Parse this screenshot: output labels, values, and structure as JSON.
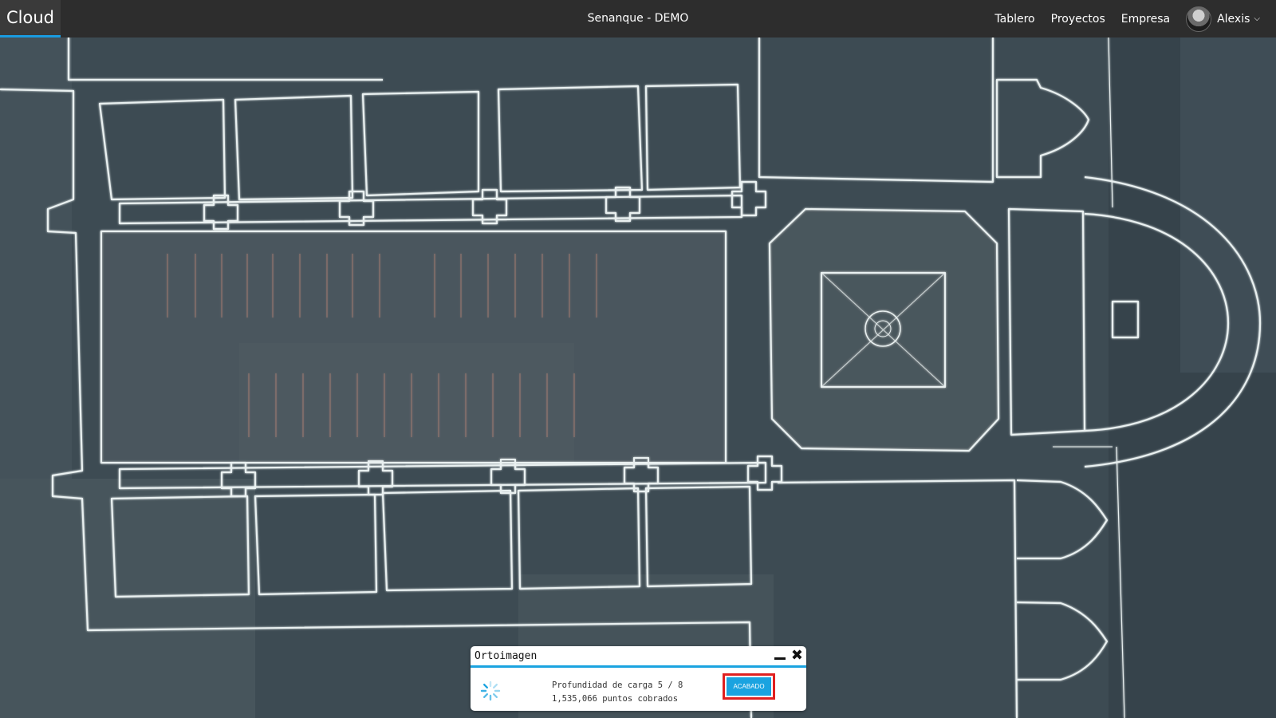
{
  "header": {
    "brand": "Cloud",
    "project_title": "Senanque - DEMO",
    "nav": [
      "Tablero",
      "Proyectos",
      "Empresa"
    ],
    "user": {
      "name": "Alexis",
      "avatar_icon": "user-avatar",
      "dropdown_icon": "chevron-down-icon"
    },
    "accent_color": "#1a9be0"
  },
  "viewer": {
    "content": "orthoimage-floorplan"
  },
  "progress_panel": {
    "title": "Ortoimagen",
    "load_depth": "Profundidad de carga 5 / 8",
    "points": "1,535,066 puntos cobrados",
    "finish_button": "ACABADO",
    "minimize_icon": "minimize-icon",
    "close_icon": "close-icon",
    "spinner_icon": "loading-spinner-icon"
  }
}
